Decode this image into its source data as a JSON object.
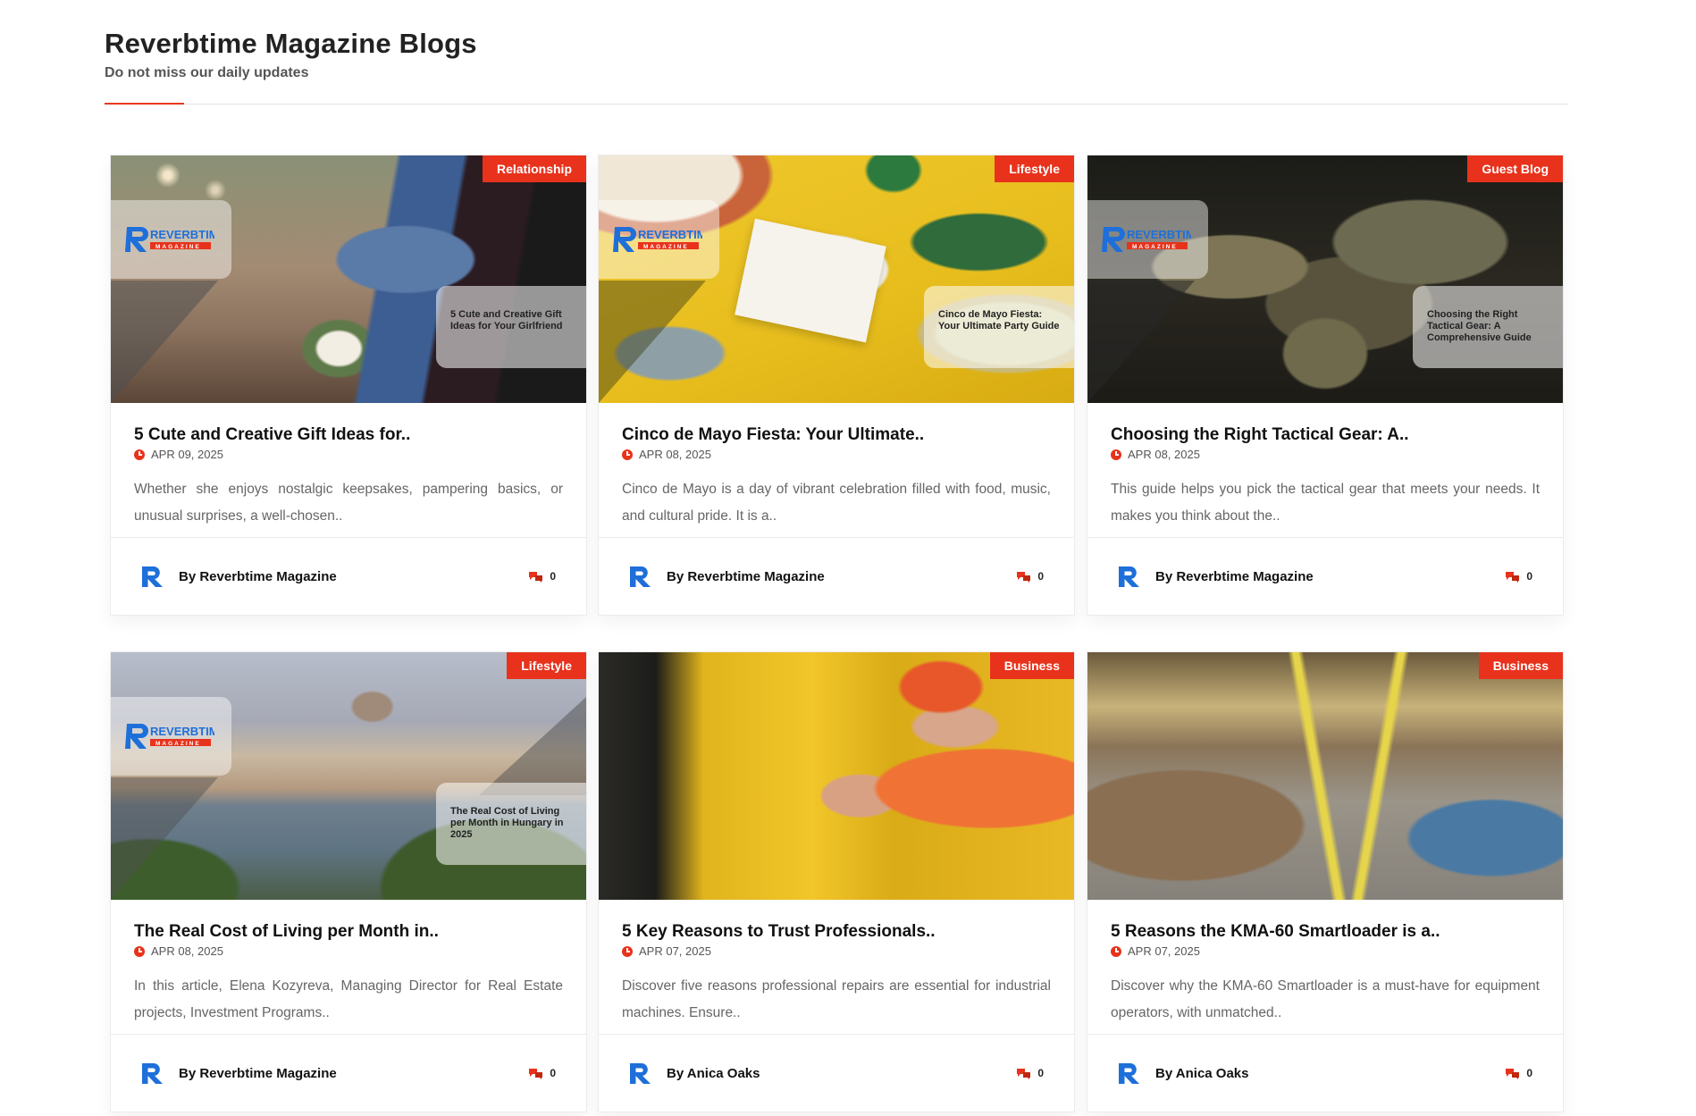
{
  "header": {
    "title": "Reverbtime Magazine Blogs",
    "subtitle": "Do not miss our daily updates"
  },
  "colors": {
    "accent": "#e8321c",
    "logo_blue": "#1e6fd9"
  },
  "cards": [
    {
      "category": "Relationship",
      "title": "5 Cute and Creative Gift Ideas for..",
      "date": "APR 09, 2025",
      "excerpt": "Whether she enjoys nostalgic keepsakes, pampering basics, or unusual surprises, a well-chosen..",
      "author": "By Reverbtime Magazine",
      "comments": "0",
      "image_overlay": "5 Cute and Creative Gift Ideas for Your Girlfriend",
      "image_theme": "woman-with-flowers"
    },
    {
      "category": "Lifestyle",
      "title": "Cinco de Mayo Fiesta: Your Ultimate..",
      "date": "APR 08, 2025",
      "excerpt": "Cinco de Mayo is a day of vibrant celebration filled with food, music, and cultural pride. It is a..",
      "author": "By Reverbtime Magazine",
      "comments": "0",
      "image_overlay": "Cinco de Mayo Fiesta: Your Ultimate Party Guide",
      "image_theme": "cinco-de-mayo-table"
    },
    {
      "category": "Guest Blog",
      "title": "Choosing the Right Tactical Gear: A..",
      "date": "APR 08, 2025",
      "excerpt": "This guide helps you pick the tactical gear that meets your needs. It makes you think about the..",
      "author": "By Reverbtime Magazine",
      "comments": "0",
      "image_overlay": "Choosing the Right Tactical Gear: A Comprehensive Guide",
      "image_theme": "tactical-vest"
    },
    {
      "category": "Lifestyle",
      "title": "The Real Cost of Living per Month in..",
      "date": "APR 08, 2025",
      "excerpt": "In this article, Elena Kozyreva, Managing Director for Real Estate projects, Investment Programs..",
      "author": "By Reverbtime Magazine",
      "comments": "0",
      "image_overlay": "The Real Cost of Living per Month in Hungary in 2025",
      "image_theme": "budapest-parliament"
    },
    {
      "category": "Business",
      "title": "5 Key Reasons to Trust Professionals..",
      "date": "APR 07, 2025",
      "excerpt": "Discover five reasons professional repairs are essential for industrial machines. Ensure..",
      "author": "By Anica Oaks",
      "comments": "0",
      "image_overlay": "",
      "image_theme": "mechanic-repair"
    },
    {
      "category": "Business",
      "title": "5 Reasons the KMA-60 Smartloader is a..",
      "date": "APR 07, 2025",
      "excerpt": "Discover why the KMA-60 Smartloader is a must-have for equipment operators, with unmatched..",
      "author": "By Anica Oaks",
      "comments": "0",
      "image_overlay": "",
      "image_theme": "factory-floor"
    }
  ],
  "logo": {
    "word": "REVERBTIME",
    "sub": "MAGAZINE"
  }
}
